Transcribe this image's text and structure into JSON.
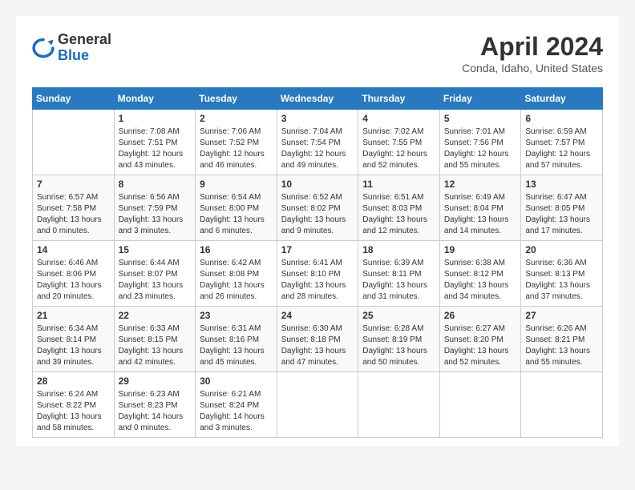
{
  "logo": {
    "general": "General",
    "blue": "Blue"
  },
  "title": "April 2024",
  "subtitle": "Conda, Idaho, United States",
  "days_header": [
    "Sunday",
    "Monday",
    "Tuesday",
    "Wednesday",
    "Thursday",
    "Friday",
    "Saturday"
  ],
  "weeks": [
    [
      {
        "num": "",
        "info": ""
      },
      {
        "num": "1",
        "info": "Sunrise: 7:08 AM\nSunset: 7:51 PM\nDaylight: 12 hours\nand 43 minutes."
      },
      {
        "num": "2",
        "info": "Sunrise: 7:06 AM\nSunset: 7:52 PM\nDaylight: 12 hours\nand 46 minutes."
      },
      {
        "num": "3",
        "info": "Sunrise: 7:04 AM\nSunset: 7:54 PM\nDaylight: 12 hours\nand 49 minutes."
      },
      {
        "num": "4",
        "info": "Sunrise: 7:02 AM\nSunset: 7:55 PM\nDaylight: 12 hours\nand 52 minutes."
      },
      {
        "num": "5",
        "info": "Sunrise: 7:01 AM\nSunset: 7:56 PM\nDaylight: 12 hours\nand 55 minutes."
      },
      {
        "num": "6",
        "info": "Sunrise: 6:59 AM\nSunset: 7:57 PM\nDaylight: 12 hours\nand 57 minutes."
      }
    ],
    [
      {
        "num": "7",
        "info": "Sunrise: 6:57 AM\nSunset: 7:58 PM\nDaylight: 13 hours\nand 0 minutes."
      },
      {
        "num": "8",
        "info": "Sunrise: 6:56 AM\nSunset: 7:59 PM\nDaylight: 13 hours\nand 3 minutes."
      },
      {
        "num": "9",
        "info": "Sunrise: 6:54 AM\nSunset: 8:00 PM\nDaylight: 13 hours\nand 6 minutes."
      },
      {
        "num": "10",
        "info": "Sunrise: 6:52 AM\nSunset: 8:02 PM\nDaylight: 13 hours\nand 9 minutes."
      },
      {
        "num": "11",
        "info": "Sunrise: 6:51 AM\nSunset: 8:03 PM\nDaylight: 13 hours\nand 12 minutes."
      },
      {
        "num": "12",
        "info": "Sunrise: 6:49 AM\nSunset: 8:04 PM\nDaylight: 13 hours\nand 14 minutes."
      },
      {
        "num": "13",
        "info": "Sunrise: 6:47 AM\nSunset: 8:05 PM\nDaylight: 13 hours\nand 17 minutes."
      }
    ],
    [
      {
        "num": "14",
        "info": "Sunrise: 6:46 AM\nSunset: 8:06 PM\nDaylight: 13 hours\nand 20 minutes."
      },
      {
        "num": "15",
        "info": "Sunrise: 6:44 AM\nSunset: 8:07 PM\nDaylight: 13 hours\nand 23 minutes."
      },
      {
        "num": "16",
        "info": "Sunrise: 6:42 AM\nSunset: 8:08 PM\nDaylight: 13 hours\nand 26 minutes."
      },
      {
        "num": "17",
        "info": "Sunrise: 6:41 AM\nSunset: 8:10 PM\nDaylight: 13 hours\nand 28 minutes."
      },
      {
        "num": "18",
        "info": "Sunrise: 6:39 AM\nSunset: 8:11 PM\nDaylight: 13 hours\nand 31 minutes."
      },
      {
        "num": "19",
        "info": "Sunrise: 6:38 AM\nSunset: 8:12 PM\nDaylight: 13 hours\nand 34 minutes."
      },
      {
        "num": "20",
        "info": "Sunrise: 6:36 AM\nSunset: 8:13 PM\nDaylight: 13 hours\nand 37 minutes."
      }
    ],
    [
      {
        "num": "21",
        "info": "Sunrise: 6:34 AM\nSunset: 8:14 PM\nDaylight: 13 hours\nand 39 minutes."
      },
      {
        "num": "22",
        "info": "Sunrise: 6:33 AM\nSunset: 8:15 PM\nDaylight: 13 hours\nand 42 minutes."
      },
      {
        "num": "23",
        "info": "Sunrise: 6:31 AM\nSunset: 8:16 PM\nDaylight: 13 hours\nand 45 minutes."
      },
      {
        "num": "24",
        "info": "Sunrise: 6:30 AM\nSunset: 8:18 PM\nDaylight: 13 hours\nand 47 minutes."
      },
      {
        "num": "25",
        "info": "Sunrise: 6:28 AM\nSunset: 8:19 PM\nDaylight: 13 hours\nand 50 minutes."
      },
      {
        "num": "26",
        "info": "Sunrise: 6:27 AM\nSunset: 8:20 PM\nDaylight: 13 hours\nand 52 minutes."
      },
      {
        "num": "27",
        "info": "Sunrise: 6:26 AM\nSunset: 8:21 PM\nDaylight: 13 hours\nand 55 minutes."
      }
    ],
    [
      {
        "num": "28",
        "info": "Sunrise: 6:24 AM\nSunset: 8:22 PM\nDaylight: 13 hours\nand 58 minutes."
      },
      {
        "num": "29",
        "info": "Sunrise: 6:23 AM\nSunset: 8:23 PM\nDaylight: 14 hours\nand 0 minutes."
      },
      {
        "num": "30",
        "info": "Sunrise: 6:21 AM\nSunset: 8:24 PM\nDaylight: 14 hours\nand 3 minutes."
      },
      {
        "num": "",
        "info": ""
      },
      {
        "num": "",
        "info": ""
      },
      {
        "num": "",
        "info": ""
      },
      {
        "num": "",
        "info": ""
      }
    ]
  ]
}
